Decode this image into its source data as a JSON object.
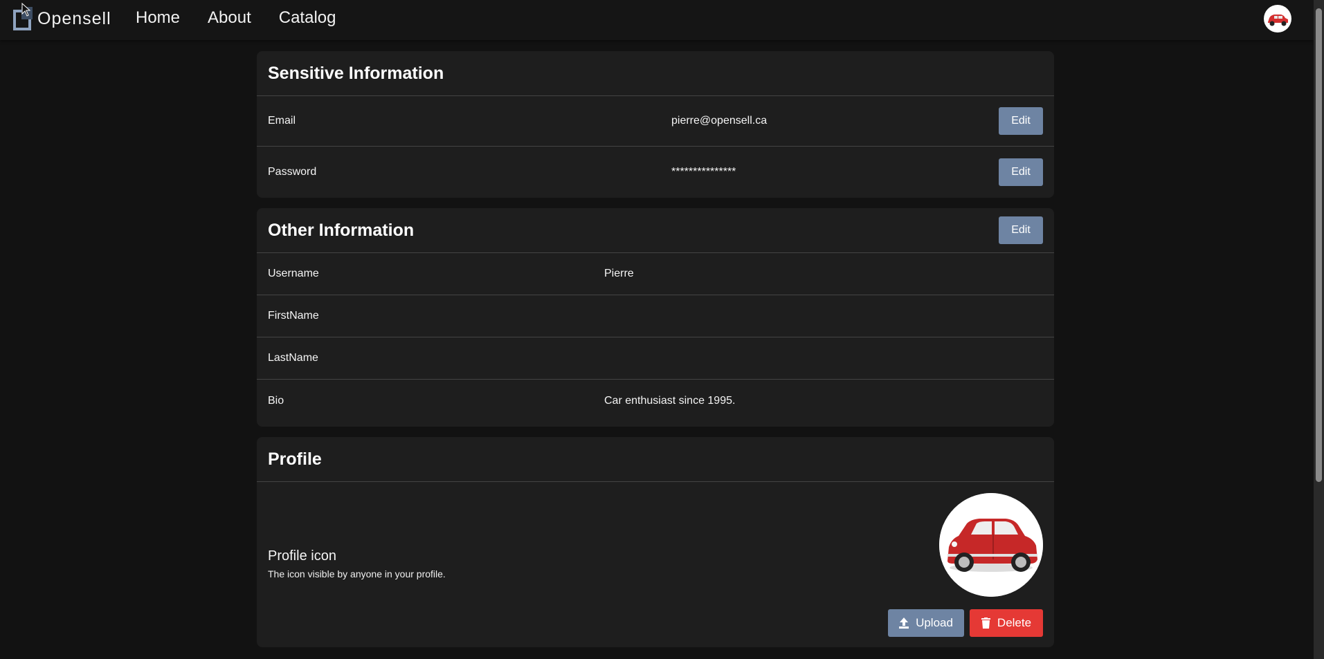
{
  "app": {
    "brand": "Opensell",
    "nav": [
      "Home",
      "About",
      "Catalog"
    ]
  },
  "sensitive": {
    "title": "Sensitive Information",
    "rows": [
      {
        "label": "Email",
        "value": "pierre@opensell.ca",
        "action": "Edit"
      },
      {
        "label": "Password",
        "value": "***************",
        "action": "Edit"
      }
    ]
  },
  "other": {
    "title": "Other Information",
    "action": "Edit",
    "rows": [
      {
        "label": "Username",
        "value": "Pierre"
      },
      {
        "label": "FirstName",
        "value": ""
      },
      {
        "label": "LastName",
        "value": ""
      },
      {
        "label": "Bio",
        "value": "Car enthusiast since 1995."
      }
    ]
  },
  "profile": {
    "title": "Profile",
    "icon_label": "Profile icon",
    "icon_description": "The icon visible by anyone in your profile.",
    "upload_label": "Upload",
    "delete_label": "Delete"
  },
  "colors": {
    "background": "#121212",
    "card": "#1e1e1e",
    "primary_button": "#6e84a3",
    "danger_button": "#e53935"
  },
  "icons": {
    "logo": "opensell-logo-icon",
    "upload": "upload-icon",
    "delete": "trash-icon",
    "avatar": "red-car-avatar"
  }
}
